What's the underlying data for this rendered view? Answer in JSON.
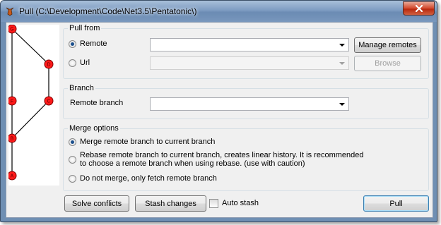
{
  "window": {
    "title": "Pull (C:\\Development\\Code\\Net3.5\\Pentatonic\\)"
  },
  "graph": {
    "nodes": [
      {
        "label": "G"
      },
      {
        "label": "D"
      },
      {
        "label": "F"
      },
      {
        "label": "C"
      },
      {
        "label": "B"
      },
      {
        "label": "A"
      }
    ]
  },
  "pull_from": {
    "title": "Pull from",
    "remote_label": "Remote",
    "url_label": "Url",
    "remote_value": "",
    "url_value": "",
    "manage_remotes": "Manage remotes",
    "browse": "Browse",
    "selected": "Remote"
  },
  "branch": {
    "title": "Branch",
    "remote_branch_label": "Remote branch",
    "remote_branch_value": ""
  },
  "merge_options": {
    "title": "Merge options",
    "merge": "Merge remote branch to current branch",
    "rebase_line1": "Rebase remote branch to current branch, creates linear history. It is recommended",
    "rebase_line2": "to choose a remote branch when using rebase. (use with caution)",
    "no_merge": "Do not merge, only fetch remote branch",
    "selected": "merge"
  },
  "footer": {
    "solve_conflicts": "Solve conflicts",
    "stash_changes": "Stash changes",
    "auto_stash": "Auto stash",
    "auto_stash_checked": false,
    "pull": "Pull"
  },
  "colors": {
    "node": "#ff1a1a",
    "node_border": "#800000",
    "edge": "#000000"
  }
}
